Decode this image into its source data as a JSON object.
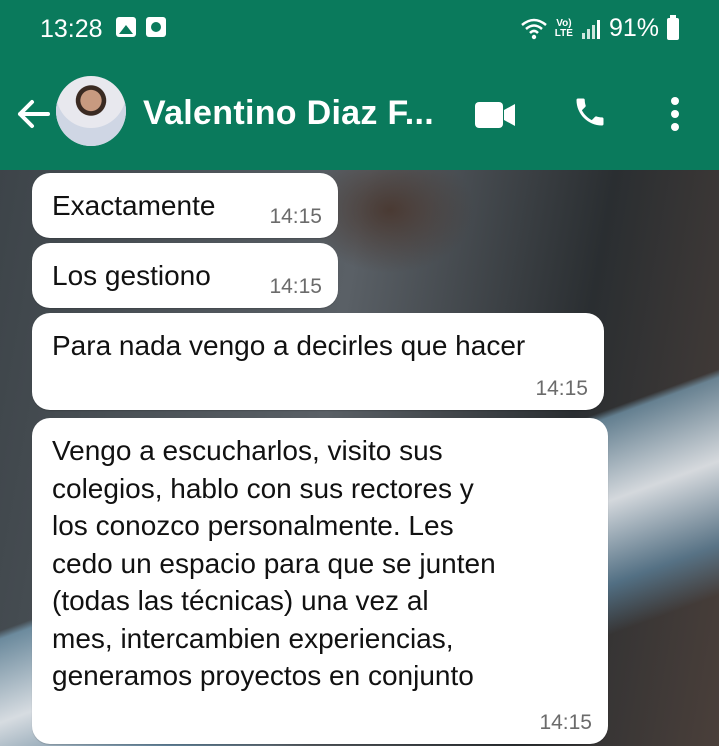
{
  "status_bar": {
    "time": "13:28",
    "volte_line1": "Vo)",
    "volte_line2": "LTE",
    "battery": "91%"
  },
  "header": {
    "contact_name": "Valentino Diaz F...",
    "colors": {
      "bar": "#0a7a5c"
    }
  },
  "messages": [
    {
      "text": "Exactamente",
      "time": "14:15"
    },
    {
      "text": "Los gestiono",
      "time": "14:15"
    },
    {
      "text": "Para nada vengo a decirles que hacer",
      "time": "14:15"
    },
    {
      "text": "Vengo a escucharlos, visito sus\ncolegios, hablo con sus rectores y\nlos conozco personalmente. Les\ncedo un espacio para que se junten\n(todas las técnicas) una vez al\nmes, intercambien experiencias,\ngeneramos proyectos en conjunto",
      "time": "14:15"
    }
  ]
}
